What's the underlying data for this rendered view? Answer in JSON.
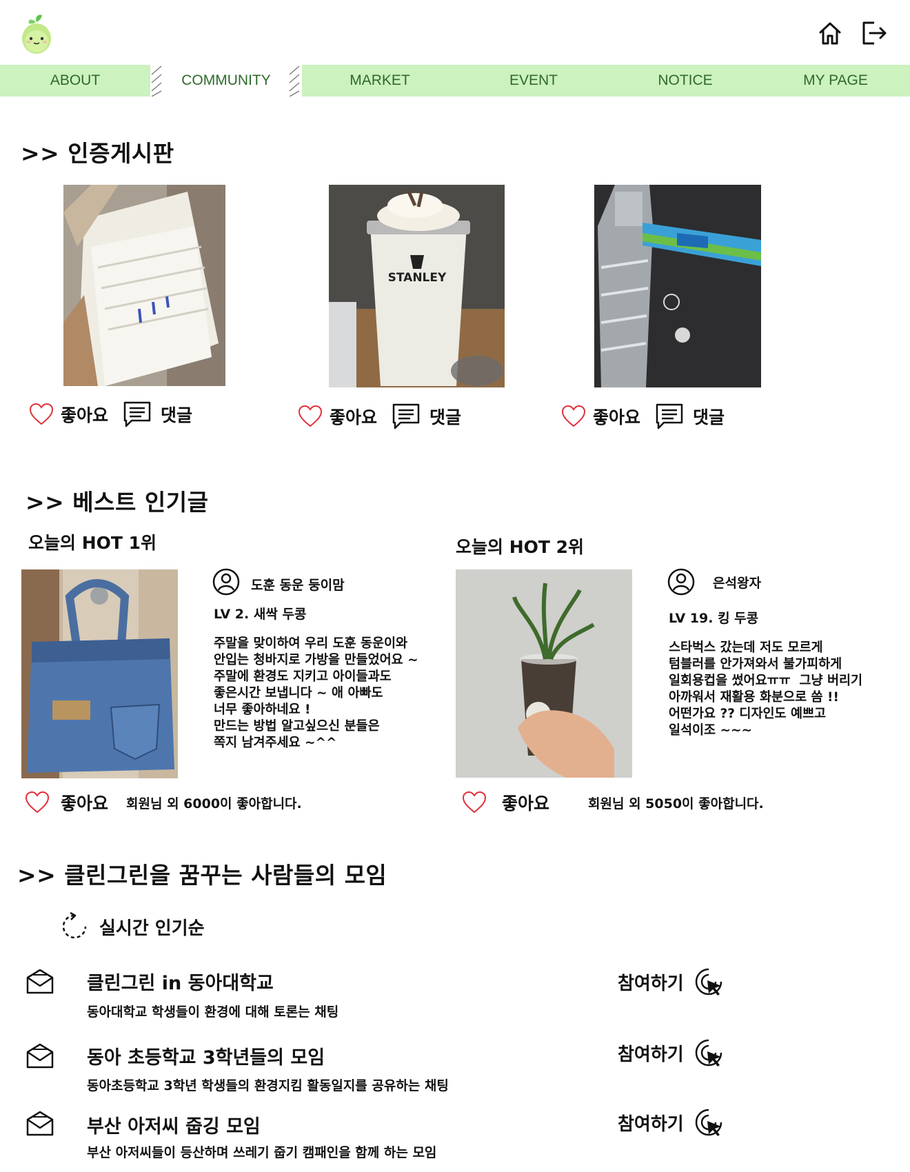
{
  "nav": {
    "items": [
      {
        "label": "ABOUT"
      },
      {
        "label": "COMMUNITY"
      },
      {
        "label": "MARKET"
      },
      {
        "label": "EVENT"
      },
      {
        "label": "NOTICE"
      },
      {
        "label": "MY PAGE"
      }
    ],
    "active": "COMMUNITY"
  },
  "header": {
    "logo_icon": "green-fruit-mascot",
    "home_icon": "home-icon",
    "logout_icon": "logout-icon"
  },
  "certification": {
    "title": ">> 인증게시판",
    "posts": [
      {
        "photo": "paper-bags-photo",
        "like_label": "좋아요",
        "comment_label": "댓글"
      },
      {
        "photo": "stanley-tumbler-photo",
        "like_label": "좋아요",
        "comment_label": "댓글"
      },
      {
        "photo": "plastic-bottle-photo",
        "like_label": "좋아요",
        "comment_label": "댓글"
      }
    ]
  },
  "best": {
    "title": ">> 베스트 인기글",
    "hot": [
      {
        "rank_label": "오늘의 HOT 1위",
        "photo": "denim-bag-photo",
        "username": "도훈 동운 둥이맘",
        "level": "LV 2. 새싹 두콩",
        "text_lines": [
          "주말을 맞이하여 우리 도훈 동운이와",
          "안입는 청바지로 가방을 만들었어요 ~",
          "주말에 환경도 지키고 아이들과도",
          "좋은시간 보냅니다 ~ 애 아빠도",
          "너무 좋아하네요 !",
          "만드는 방법 알고싶으신 분들은",
          "쪽지 남겨주세요 ~^^"
        ],
        "like_label": "좋아요",
        "like_count_text": "회원님 외 6000이 좋아합니다."
      },
      {
        "rank_label": "오늘의 HOT 2위",
        "photo": "plant-in-cup-photo",
        "username": "은석왕자",
        "level": "LV 19. 킹 두콩",
        "text_lines": [
          "스타벅스 갔는데 저도 모르게",
          "텀블러를 안가져와서 불가피하게",
          "일회용컵을 썼어요ㅠㅠ  그냥 버리기",
          "아까워서 재활용 화분으로 씀 !!",
          "어떤가요 ?? 디자인도 예쁘고",
          "일석이조 ~~~"
        ],
        "like_label": "좋아요",
        "like_count_text": "회원님 외 5050이 좋아합니다."
      }
    ]
  },
  "community": {
    "title": ">> 클린그린을 꿈꾸는 사람들의 모임",
    "sort_label": "실시간 인기순",
    "join_label": "참여하기",
    "rooms": [
      {
        "title": "클린그린 in 동아대학교",
        "desc": "동아대학교 학생들이 환경에 대해 토론는 채팅"
      },
      {
        "title": "동아 초등학교 3학년들의 모임",
        "desc": "동아초등학교 3학년 학생들의 환경지킴 활동일지를 공유하는 채팅"
      },
      {
        "title": "부산 아저씨 줍깅 모임",
        "desc": "부산 아저씨들이 등산하며 쓰레기 줍기 캠패인을 함께 하는 모임"
      }
    ]
  },
  "colors": {
    "nav_bg": "#ccf2bf",
    "nav_text": "#2f6a2a",
    "heart": "#e0303a",
    "text": "#111111"
  }
}
